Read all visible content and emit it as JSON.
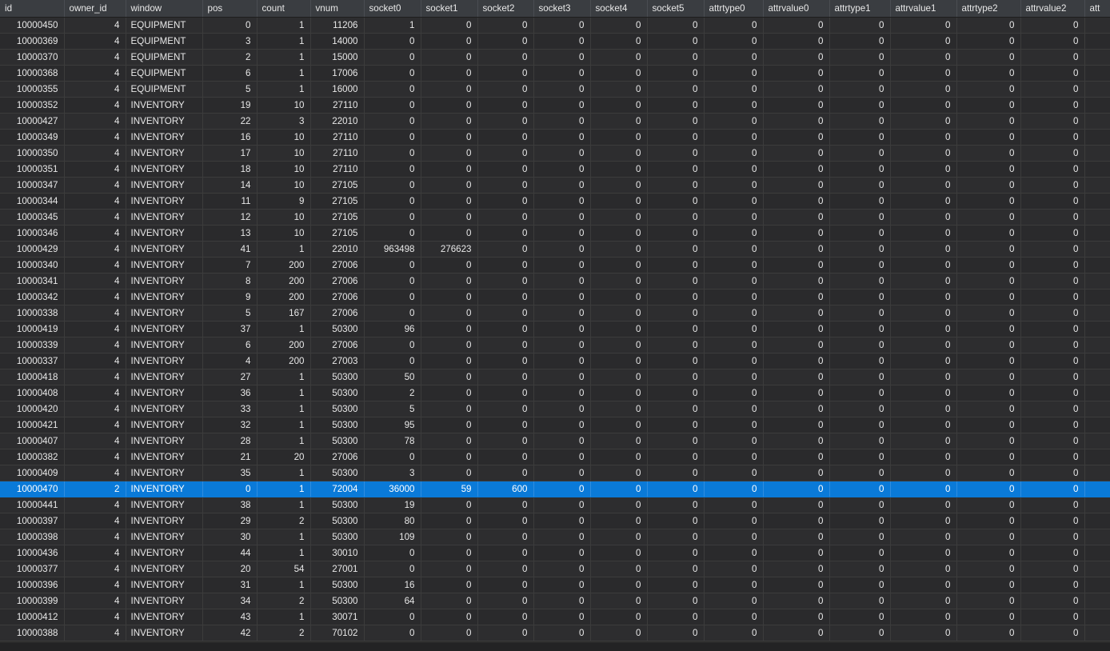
{
  "columns": [
    "id",
    "owner_id",
    "window",
    "pos",
    "count",
    "vnum",
    "socket0",
    "socket1",
    "socket2",
    "socket3",
    "socket4",
    "socket5",
    "attrtype0",
    "attrvalue0",
    "attrtype1",
    "attrvalue1",
    "attrtype2",
    "attrvalue2",
    "att"
  ],
  "rows": [
    [
      "10000450",
      "4",
      "EQUIPMENT",
      "0",
      "1",
      "11206",
      "1",
      "0",
      "0",
      "0",
      "0",
      "0",
      "0",
      "0",
      "0",
      "0",
      "0",
      "0",
      ""
    ],
    [
      "10000369",
      "4",
      "EQUIPMENT",
      "3",
      "1",
      "14000",
      "0",
      "0",
      "0",
      "0",
      "0",
      "0",
      "0",
      "0",
      "0",
      "0",
      "0",
      "0",
      ""
    ],
    [
      "10000370",
      "4",
      "EQUIPMENT",
      "2",
      "1",
      "15000",
      "0",
      "0",
      "0",
      "0",
      "0",
      "0",
      "0",
      "0",
      "0",
      "0",
      "0",
      "0",
      ""
    ],
    [
      "10000368",
      "4",
      "EQUIPMENT",
      "6",
      "1",
      "17006",
      "0",
      "0",
      "0",
      "0",
      "0",
      "0",
      "0",
      "0",
      "0",
      "0",
      "0",
      "0",
      ""
    ],
    [
      "10000355",
      "4",
      "EQUIPMENT",
      "5",
      "1",
      "16000",
      "0",
      "0",
      "0",
      "0",
      "0",
      "0",
      "0",
      "0",
      "0",
      "0",
      "0",
      "0",
      ""
    ],
    [
      "10000352",
      "4",
      "INVENTORY",
      "19",
      "10",
      "27110",
      "0",
      "0",
      "0",
      "0",
      "0",
      "0",
      "0",
      "0",
      "0",
      "0",
      "0",
      "0",
      ""
    ],
    [
      "10000427",
      "4",
      "INVENTORY",
      "22",
      "3",
      "22010",
      "0",
      "0",
      "0",
      "0",
      "0",
      "0",
      "0",
      "0",
      "0",
      "0",
      "0",
      "0",
      ""
    ],
    [
      "10000349",
      "4",
      "INVENTORY",
      "16",
      "10",
      "27110",
      "0",
      "0",
      "0",
      "0",
      "0",
      "0",
      "0",
      "0",
      "0",
      "0",
      "0",
      "0",
      ""
    ],
    [
      "10000350",
      "4",
      "INVENTORY",
      "17",
      "10",
      "27110",
      "0",
      "0",
      "0",
      "0",
      "0",
      "0",
      "0",
      "0",
      "0",
      "0",
      "0",
      "0",
      ""
    ],
    [
      "10000351",
      "4",
      "INVENTORY",
      "18",
      "10",
      "27110",
      "0",
      "0",
      "0",
      "0",
      "0",
      "0",
      "0",
      "0",
      "0",
      "0",
      "0",
      "0",
      ""
    ],
    [
      "10000347",
      "4",
      "INVENTORY",
      "14",
      "10",
      "27105",
      "0",
      "0",
      "0",
      "0",
      "0",
      "0",
      "0",
      "0",
      "0",
      "0",
      "0",
      "0",
      ""
    ],
    [
      "10000344",
      "4",
      "INVENTORY",
      "11",
      "9",
      "27105",
      "0",
      "0",
      "0",
      "0",
      "0",
      "0",
      "0",
      "0",
      "0",
      "0",
      "0",
      "0",
      ""
    ],
    [
      "10000345",
      "4",
      "INVENTORY",
      "12",
      "10",
      "27105",
      "0",
      "0",
      "0",
      "0",
      "0",
      "0",
      "0",
      "0",
      "0",
      "0",
      "0",
      "0",
      ""
    ],
    [
      "10000346",
      "4",
      "INVENTORY",
      "13",
      "10",
      "27105",
      "0",
      "0",
      "0",
      "0",
      "0",
      "0",
      "0",
      "0",
      "0",
      "0",
      "0",
      "0",
      ""
    ],
    [
      "10000429",
      "4",
      "INVENTORY",
      "41",
      "1",
      "22010",
      "963498",
      "276623",
      "0",
      "0",
      "0",
      "0",
      "0",
      "0",
      "0",
      "0",
      "0",
      "0",
      ""
    ],
    [
      "10000340",
      "4",
      "INVENTORY",
      "7",
      "200",
      "27006",
      "0",
      "0",
      "0",
      "0",
      "0",
      "0",
      "0",
      "0",
      "0",
      "0",
      "0",
      "0",
      ""
    ],
    [
      "10000341",
      "4",
      "INVENTORY",
      "8",
      "200",
      "27006",
      "0",
      "0",
      "0",
      "0",
      "0",
      "0",
      "0",
      "0",
      "0",
      "0",
      "0",
      "0",
      ""
    ],
    [
      "10000342",
      "4",
      "INVENTORY",
      "9",
      "200",
      "27006",
      "0",
      "0",
      "0",
      "0",
      "0",
      "0",
      "0",
      "0",
      "0",
      "0",
      "0",
      "0",
      ""
    ],
    [
      "10000338",
      "4",
      "INVENTORY",
      "5",
      "167",
      "27006",
      "0",
      "0",
      "0",
      "0",
      "0",
      "0",
      "0",
      "0",
      "0",
      "0",
      "0",
      "0",
      ""
    ],
    [
      "10000419",
      "4",
      "INVENTORY",
      "37",
      "1",
      "50300",
      "96",
      "0",
      "0",
      "0",
      "0",
      "0",
      "0",
      "0",
      "0",
      "0",
      "0",
      "0",
      ""
    ],
    [
      "10000339",
      "4",
      "INVENTORY",
      "6",
      "200",
      "27006",
      "0",
      "0",
      "0",
      "0",
      "0",
      "0",
      "0",
      "0",
      "0",
      "0",
      "0",
      "0",
      ""
    ],
    [
      "10000337",
      "4",
      "INVENTORY",
      "4",
      "200",
      "27003",
      "0",
      "0",
      "0",
      "0",
      "0",
      "0",
      "0",
      "0",
      "0",
      "0",
      "0",
      "0",
      ""
    ],
    [
      "10000418",
      "4",
      "INVENTORY",
      "27",
      "1",
      "50300",
      "50",
      "0",
      "0",
      "0",
      "0",
      "0",
      "0",
      "0",
      "0",
      "0",
      "0",
      "0",
      ""
    ],
    [
      "10000408",
      "4",
      "INVENTORY",
      "36",
      "1",
      "50300",
      "2",
      "0",
      "0",
      "0",
      "0",
      "0",
      "0",
      "0",
      "0",
      "0",
      "0",
      "0",
      ""
    ],
    [
      "10000420",
      "4",
      "INVENTORY",
      "33",
      "1",
      "50300",
      "5",
      "0",
      "0",
      "0",
      "0",
      "0",
      "0",
      "0",
      "0",
      "0",
      "0",
      "0",
      ""
    ],
    [
      "10000421",
      "4",
      "INVENTORY",
      "32",
      "1",
      "50300",
      "95",
      "0",
      "0",
      "0",
      "0",
      "0",
      "0",
      "0",
      "0",
      "0",
      "0",
      "0",
      ""
    ],
    [
      "10000407",
      "4",
      "INVENTORY",
      "28",
      "1",
      "50300",
      "78",
      "0",
      "0",
      "0",
      "0",
      "0",
      "0",
      "0",
      "0",
      "0",
      "0",
      "0",
      ""
    ],
    [
      "10000382",
      "4",
      "INVENTORY",
      "21",
      "20",
      "27006",
      "0",
      "0",
      "0",
      "0",
      "0",
      "0",
      "0",
      "0",
      "0",
      "0",
      "0",
      "0",
      ""
    ],
    [
      "10000409",
      "4",
      "INVENTORY",
      "35",
      "1",
      "50300",
      "3",
      "0",
      "0",
      "0",
      "0",
      "0",
      "0",
      "0",
      "0",
      "0",
      "0",
      "0",
      ""
    ],
    [
      "10000470",
      "2",
      "INVENTORY",
      "0",
      "1",
      "72004",
      "36000",
      "59",
      "600",
      "0",
      "0",
      "0",
      "0",
      "0",
      "0",
      "0",
      "0",
      "0",
      ""
    ],
    [
      "10000441",
      "4",
      "INVENTORY",
      "38",
      "1",
      "50300",
      "19",
      "0",
      "0",
      "0",
      "0",
      "0",
      "0",
      "0",
      "0",
      "0",
      "0",
      "0",
      ""
    ],
    [
      "10000397",
      "4",
      "INVENTORY",
      "29",
      "2",
      "50300",
      "80",
      "0",
      "0",
      "0",
      "0",
      "0",
      "0",
      "0",
      "0",
      "0",
      "0",
      "0",
      ""
    ],
    [
      "10000398",
      "4",
      "INVENTORY",
      "30",
      "1",
      "50300",
      "109",
      "0",
      "0",
      "0",
      "0",
      "0",
      "0",
      "0",
      "0",
      "0",
      "0",
      "0",
      ""
    ],
    [
      "10000436",
      "4",
      "INVENTORY",
      "44",
      "1",
      "30010",
      "0",
      "0",
      "0",
      "0",
      "0",
      "0",
      "0",
      "0",
      "0",
      "0",
      "0",
      "0",
      ""
    ],
    [
      "10000377",
      "4",
      "INVENTORY",
      "20",
      "54",
      "27001",
      "0",
      "0",
      "0",
      "0",
      "0",
      "0",
      "0",
      "0",
      "0",
      "0",
      "0",
      "0",
      ""
    ],
    [
      "10000396",
      "4",
      "INVENTORY",
      "31",
      "1",
      "50300",
      "16",
      "0",
      "0",
      "0",
      "0",
      "0",
      "0",
      "0",
      "0",
      "0",
      "0",
      "0",
      ""
    ],
    [
      "10000399",
      "4",
      "INVENTORY",
      "34",
      "2",
      "50300",
      "64",
      "0",
      "0",
      "0",
      "0",
      "0",
      "0",
      "0",
      "0",
      "0",
      "0",
      "0",
      ""
    ],
    [
      "10000412",
      "4",
      "INVENTORY",
      "43",
      "1",
      "30071",
      "0",
      "0",
      "0",
      "0",
      "0",
      "0",
      "0",
      "0",
      "0",
      "0",
      "0",
      "0",
      ""
    ],
    [
      "10000388",
      "4",
      "INVENTORY",
      "42",
      "2",
      "70102",
      "0",
      "0",
      "0",
      "0",
      "0",
      "0",
      "0",
      "0",
      "0",
      "0",
      "0",
      "0",
      ""
    ]
  ],
  "selected_row_id": "10000470",
  "colors": {
    "background": "#2b2b2b",
    "header": "#3a3d41",
    "selection": "#0a7ad8",
    "text": "#e8e8e8"
  }
}
